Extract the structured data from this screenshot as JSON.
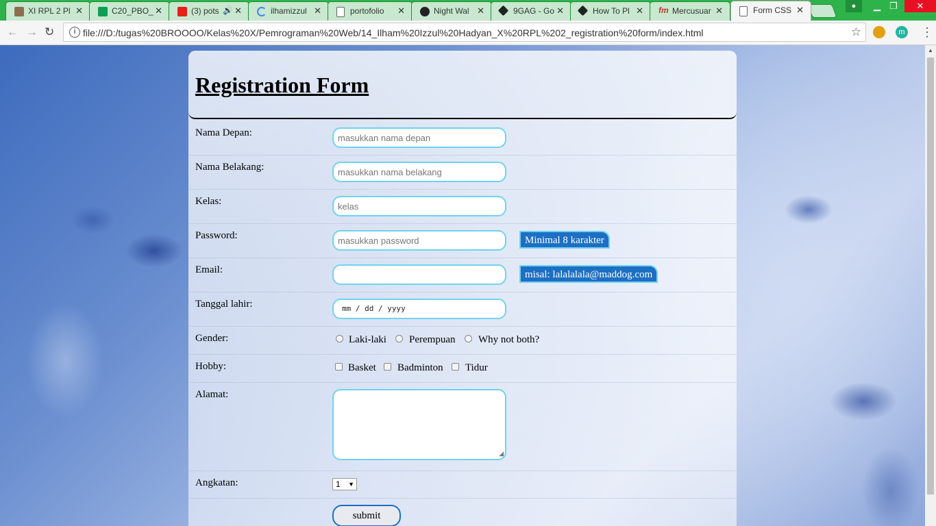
{
  "browser": {
    "tabs": [
      {
        "title": "XI RPL 2 Pl",
        "icon": "classroom-icon",
        "color": "#8d6e4f"
      },
      {
        "title": "C20_PBO_",
        "icon": "sheets-icon",
        "color": "#0f9d58"
      },
      {
        "title": "(3) pots",
        "icon": "youtube-icon",
        "color": "#e62117"
      },
      {
        "title": "ilhamizzul",
        "icon": "loading-icon",
        "color": "#4285f4"
      },
      {
        "title": "portofolio",
        "icon": "document-icon",
        "color": "#888888"
      },
      {
        "title": "Night Wal",
        "icon": "music-icon",
        "color": "#222222"
      },
      {
        "title": "9GAG - Go",
        "icon": "9gag-icon",
        "color": "#222222"
      },
      {
        "title": "How To Pl",
        "icon": "9gag-icon",
        "color": "#222222"
      },
      {
        "title": "Mercusuar",
        "icon": "fm-icon",
        "color": "#c0392b"
      },
      {
        "title": "Form CSS",
        "icon": "document-icon",
        "color": "#888888"
      }
    ],
    "url": "file:///D:/tugas%20BROOOO/Kelas%20X/Pemrograman%20Web/14_Ilham%20Izzul%20Hadyan_X%20RPL%202_registration%20form/index.html",
    "ext_label": "m"
  },
  "form": {
    "title": "Registration Form",
    "fields": {
      "first_name": {
        "label": "Nama Depan:",
        "placeholder": "masukkan nama depan"
      },
      "last_name": {
        "label": "Nama Belakang:",
        "placeholder": "masukkan nama belakang"
      },
      "kelas": {
        "label": "Kelas:",
        "placeholder": "kelas"
      },
      "password": {
        "label": "Password:",
        "placeholder": "masukkan password",
        "hint": "Minimal 8 karakter"
      },
      "email": {
        "label": "Email:",
        "placeholder": "",
        "hint": "misal: lalalalala@maddog.com"
      },
      "birthdate": {
        "label": "Tanggal lahir:",
        "value": "mm / dd / yyyy"
      },
      "gender": {
        "label": "Gender:",
        "options": [
          "Laki-laki",
          "Perempuan",
          "Why not both?"
        ]
      },
      "hobby": {
        "label": "Hobby:",
        "options": [
          "Basket",
          "Badminton",
          "Tidur"
        ]
      },
      "alamat": {
        "label": "Alamat:"
      },
      "angkatan": {
        "label": "Angkatan:",
        "selected": "1"
      }
    },
    "submit_label": "submit"
  },
  "colors": {
    "chrome_green": "#2eb34b",
    "input_border": "#6fd3f0",
    "hint_bg": "#1d6fc4"
  }
}
